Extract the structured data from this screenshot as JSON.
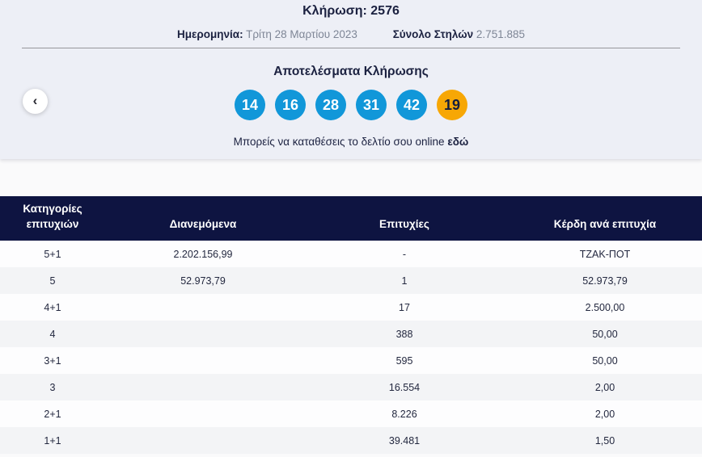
{
  "draw": {
    "title_label": "Κλήρωση:",
    "title_number": "2576",
    "date_label": "Ημερομηνία:",
    "date_value": "Τρίτη 28 Μαρτίου 2023",
    "columns_label": "Σύνολο Στηλών",
    "columns_value": "2.751.885"
  },
  "nav": {
    "prev_icon": "‹"
  },
  "results": {
    "title": "Αποτελέσματα Κλήρωσης",
    "numbers": [
      "14",
      "16",
      "28",
      "31",
      "42"
    ],
    "joker_number": "19",
    "cta_text": "Μπορείς να καταθέσεις το δελτίο σου online",
    "cta_link_text": "εδώ"
  },
  "table": {
    "headers": {
      "category_line1": "Κατηγορίες",
      "category_line2": "επιτυχιών",
      "distributed": "Διανεμόμενα",
      "winners": "Επιτυχίες",
      "prize_per_win": "Κέρδη ανά επιτυχία"
    },
    "rows": [
      [
        "5+1",
        "2.202.156,99",
        "-",
        "ΤΖΑΚ-ΠΟΤ"
      ],
      [
        "5",
        "52.973,79",
        "1",
        "52.973,79"
      ],
      [
        "4+1",
        "",
        "17",
        "2.500,00"
      ],
      [
        "4",
        "",
        "388",
        "50,00"
      ],
      [
        "3+1",
        "",
        "595",
        "50,00"
      ],
      [
        "3",
        "",
        "16.554",
        "2,00"
      ],
      [
        "2+1",
        "",
        "8.226",
        "2,00"
      ],
      [
        "1+1",
        "",
        "39.481",
        "1,50"
      ]
    ]
  },
  "colors": {
    "ball_blue": "#1197d9",
    "ball_orange": "#f7a705",
    "header_navy": "#0e1441",
    "card_background": "#edeff6",
    "row_alt": "#f3f4f6"
  }
}
